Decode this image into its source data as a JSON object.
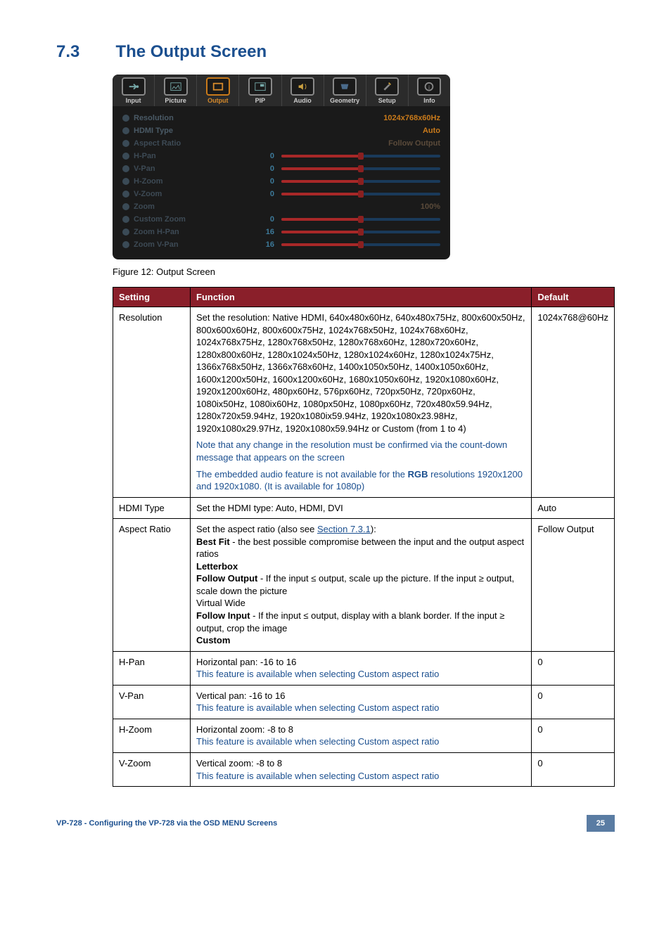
{
  "heading": {
    "number": "7.3",
    "title": "The Output Screen"
  },
  "osd": {
    "tabs": [
      {
        "label": "Input",
        "active": false
      },
      {
        "label": "Picture",
        "active": false
      },
      {
        "label": "Output",
        "active": true
      },
      {
        "label": "PIP",
        "active": false
      },
      {
        "label": "Audio",
        "active": false
      },
      {
        "label": "Geometry",
        "active": false
      },
      {
        "label": "Setup",
        "active": false
      },
      {
        "label": "Info",
        "active": false
      }
    ],
    "rows": [
      {
        "label": "Resolution",
        "valtext": "1024x768x60Hz",
        "type": "text"
      },
      {
        "label": "HDMI Type",
        "valtext": "Auto",
        "type": "text"
      },
      {
        "label": "Aspect Ratio",
        "valtext": "Follow Output",
        "type": "text",
        "dim": true
      },
      {
        "label": "H-Pan",
        "val": "0",
        "type": "slider",
        "fill": 50,
        "dim": true
      },
      {
        "label": "V-Pan",
        "val": "0",
        "type": "slider",
        "fill": 50,
        "dim": true
      },
      {
        "label": "H-Zoom",
        "val": "0",
        "type": "slider",
        "fill": 50,
        "dim": true
      },
      {
        "label": "V-Zoom",
        "val": "0",
        "type": "slider",
        "fill": 50,
        "dim": true
      },
      {
        "label": "Zoom",
        "valtext": "100%",
        "type": "text",
        "dim": true
      },
      {
        "label": "Custom Zoom",
        "val": "0",
        "type": "slider",
        "fill": 50,
        "dim": true
      },
      {
        "label": "Zoom H-Pan",
        "val": "16",
        "type": "slider",
        "fill": 50,
        "dim": true
      },
      {
        "label": "Zoom V-Pan",
        "val": "16",
        "type": "slider",
        "fill": 50,
        "dim": true
      }
    ]
  },
  "caption": "Figure 12: Output Screen",
  "table": {
    "headers": [
      "Setting",
      "Function",
      "Default"
    ],
    "rows": [
      {
        "setting": "Resolution",
        "function_main": "Set the resolution: Native HDMI, 640x480x60Hz, 640x480x75Hz, 800x600x50Hz, 800x600x60Hz, 800x600x75Hz, 1024x768x50Hz, 1024x768x60Hz, 1024x768x75Hz, 1280x768x50Hz, 1280x768x60Hz, 1280x720x60Hz, 1280x800x60Hz, 1280x1024x50Hz, 1280x1024x60Hz, 1280x1024x75Hz, 1366x768x50Hz, 1366x768x60Hz, 1400x1050x50Hz, 1400x1050x60Hz, 1600x1200x50Hz, 1600x1200x60Hz, 1680x1050x60Hz, 1920x1080x60Hz, 1920x1200x60Hz, 480px60Hz, 576px60Hz, 720px50Hz, 720px60Hz, 1080ix50Hz, 1080ix60Hz, 1080px50Hz, 1080px60Hz, 720x480x59.94Hz, 1280x720x59.94Hz, 1920x1080ix59.94Hz, 1920x1080x23.98Hz, 1920x1080x29.97Hz, 1920x1080x59.94Hz or Custom (from 1 to 4)",
        "note1": "Note that any change in the resolution must be confirmed via the count-down message that appears on the screen",
        "note2a": "The embedded audio feature is not available for the ",
        "note2b": "RGB",
        "note2c": " resolutions 1920x1200 and 1920x1080. (It is available for 1080p)",
        "default": "1024x768@60Hz"
      },
      {
        "setting": "HDMI Type",
        "function_main": "Set the HDMI type: Auto, HDMI, DVI",
        "default": "Auto"
      },
      {
        "setting": "Aspect Ratio",
        "ar_intro": "Set the aspect ratio (also see ",
        "ar_link": "Section 7.3.1",
        "ar_intro_after": "):",
        "ar_bestfit_b": "Best Fit",
        "ar_bestfit": " - the best possible compromise between the input and the output aspect ratios",
        "ar_letterbox": "Letterbox",
        "ar_followoutput_b": "Follow Output",
        "ar_followoutput": " - If the input ≤ output, scale up the picture. If the input ≥ output, scale down the picture",
        "ar_virtualwide": "Virtual Wide",
        "ar_followinput_b": "Follow Input",
        "ar_followinput": " - If the input ≤ output, display with a blank border. If the input ≥ output, crop the image",
        "ar_custom": "Custom",
        "default": "Follow Output"
      },
      {
        "setting": "H-Pan",
        "function_main": "Horizontal pan: -16 to 16",
        "note1": "This feature is available when selecting Custom aspect ratio",
        "default": "0"
      },
      {
        "setting": "V-Pan",
        "function_main": "Vertical pan: -16 to 16",
        "note1": "This feature is available when selecting Custom aspect ratio",
        "default": "0"
      },
      {
        "setting": "H-Zoom",
        "function_main": "Horizontal zoom: -8 to 8",
        "note1": "This feature is available when selecting Custom aspect ratio",
        "default": "0"
      },
      {
        "setting": "V-Zoom",
        "function_main": "Vertical zoom: -8 to 8",
        "note1": "This feature is available when selecting Custom aspect ratio",
        "default": "0"
      }
    ]
  },
  "footer": {
    "left": "VP-728 - Configuring the VP-728 via the OSD MENU Screens",
    "page": "25"
  }
}
